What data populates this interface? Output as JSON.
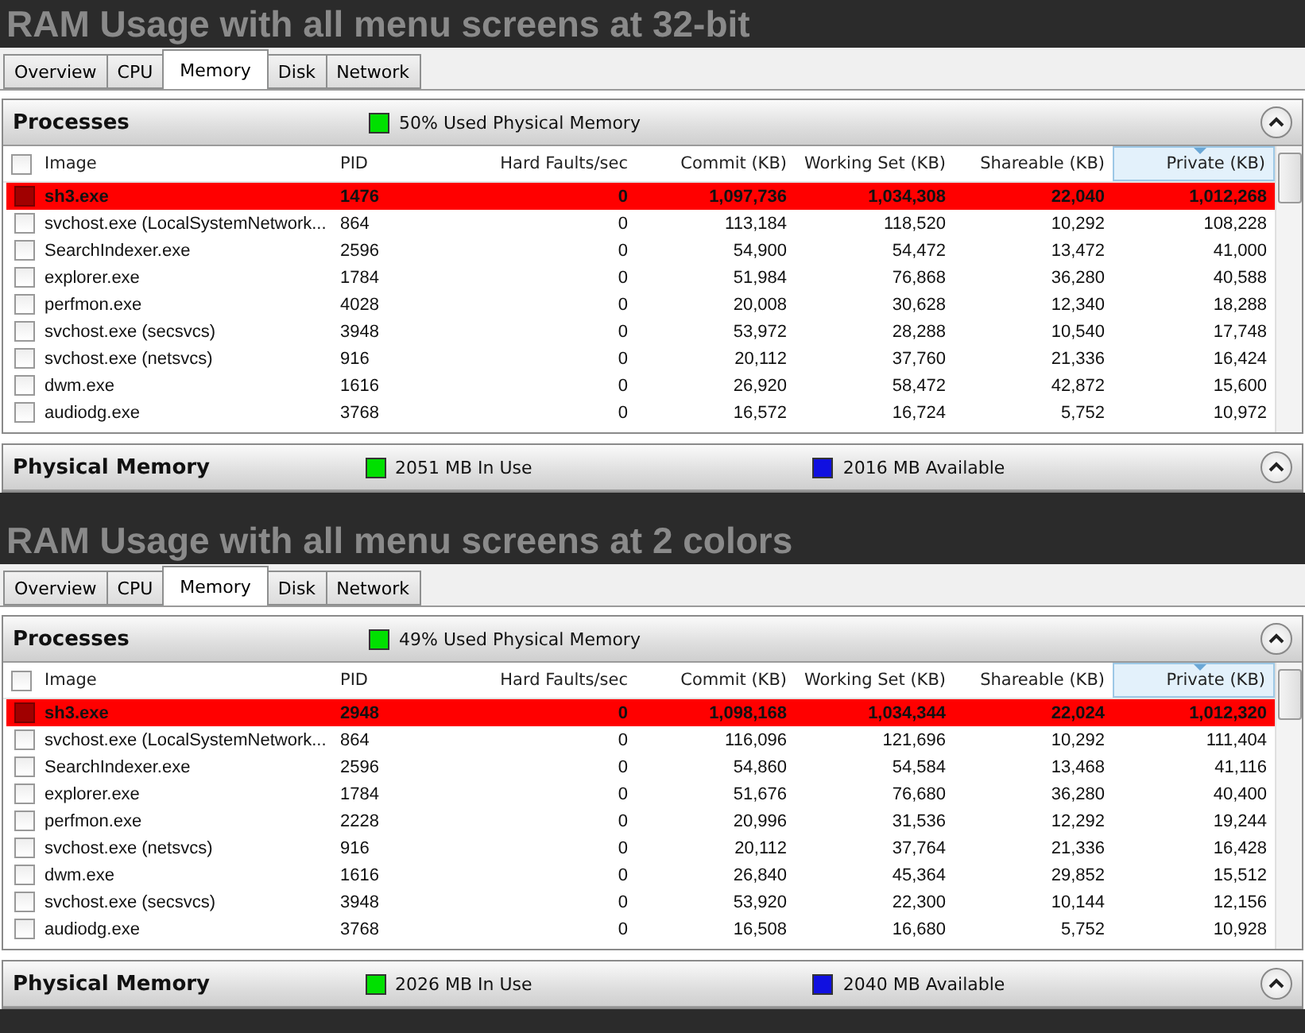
{
  "panels": [
    {
      "title": "RAM Usage with all menu screens at 32-bit",
      "tabs": [
        {
          "label": "Overview",
          "selected": false
        },
        {
          "label": "CPU",
          "selected": false
        },
        {
          "label": "Memory",
          "selected": true
        },
        {
          "label": "Disk",
          "selected": false
        },
        {
          "label": "Network",
          "selected": false
        }
      ],
      "processes": {
        "title": "Processes",
        "legend": {
          "label": "50% Used Physical Memory",
          "color": "#00e000"
        }
      },
      "columns": [
        {
          "label": "Image",
          "sorted": false
        },
        {
          "label": "PID",
          "sorted": false
        },
        {
          "label": "Hard Faults/sec",
          "sorted": false
        },
        {
          "label": "Commit (KB)",
          "sorted": false
        },
        {
          "label": "Working Set (KB)",
          "sorted": false
        },
        {
          "label": "Shareable (KB)",
          "sorted": false
        },
        {
          "label": "Private (KB)",
          "sorted": true
        }
      ],
      "rows": [
        {
          "cells": [
            "sh3.exe",
            "1476",
            "0",
            "1,097,736",
            "1,034,308",
            "22,040",
            "1,012,268"
          ],
          "selected": true,
          "checked": false
        },
        {
          "cells": [
            "svchost.exe (LocalSystemNetwork...",
            "864",
            "0",
            "113,184",
            "118,520",
            "10,292",
            "108,228"
          ],
          "selected": false,
          "checked": false
        },
        {
          "cells": [
            "SearchIndexer.exe",
            "2596",
            "0",
            "54,900",
            "54,472",
            "13,472",
            "41,000"
          ],
          "selected": false,
          "checked": false
        },
        {
          "cells": [
            "explorer.exe",
            "1784",
            "0",
            "51,984",
            "76,868",
            "36,280",
            "40,588"
          ],
          "selected": false,
          "checked": false
        },
        {
          "cells": [
            "perfmon.exe",
            "4028",
            "0",
            "20,008",
            "30,628",
            "12,340",
            "18,288"
          ],
          "selected": false,
          "checked": false
        },
        {
          "cells": [
            "svchost.exe (secsvcs)",
            "3948",
            "0",
            "53,972",
            "28,288",
            "10,540",
            "17,748"
          ],
          "selected": false,
          "checked": false
        },
        {
          "cells": [
            "svchost.exe (netsvcs)",
            "916",
            "0",
            "20,112",
            "37,760",
            "21,336",
            "16,424"
          ],
          "selected": false,
          "checked": false
        },
        {
          "cells": [
            "dwm.exe",
            "1616",
            "0",
            "26,920",
            "58,472",
            "42,872",
            "15,600"
          ],
          "selected": false,
          "checked": false
        },
        {
          "cells": [
            "audiodg.exe",
            "3768",
            "0",
            "16,572",
            "16,724",
            "5,752",
            "10,972"
          ],
          "selected": false,
          "checked": false
        }
      ],
      "physical": {
        "title": "Physical Memory",
        "legends": [
          {
            "label": "2051 MB In Use",
            "color": "#00e000"
          },
          {
            "label": "2016 MB Available",
            "color": "#1010e0"
          }
        ]
      }
    },
    {
      "title": "RAM Usage with all menu screens at 2 colors",
      "tabs": [
        {
          "label": "Overview",
          "selected": false
        },
        {
          "label": "CPU",
          "selected": false
        },
        {
          "label": "Memory",
          "selected": true
        },
        {
          "label": "Disk",
          "selected": false
        },
        {
          "label": "Network",
          "selected": false
        }
      ],
      "processes": {
        "title": "Processes",
        "legend": {
          "label": "49% Used Physical Memory",
          "color": "#00e000"
        }
      },
      "columns": [
        {
          "label": "Image",
          "sorted": false
        },
        {
          "label": "PID",
          "sorted": false
        },
        {
          "label": "Hard Faults/sec",
          "sorted": false
        },
        {
          "label": "Commit (KB)",
          "sorted": false
        },
        {
          "label": "Working Set (KB)",
          "sorted": false
        },
        {
          "label": "Shareable (KB)",
          "sorted": false
        },
        {
          "label": "Private (KB)",
          "sorted": true
        }
      ],
      "rows": [
        {
          "cells": [
            "sh3.exe",
            "2948",
            "0",
            "1,098,168",
            "1,034,344",
            "22,024",
            "1,012,320"
          ],
          "selected": true,
          "checked": false
        },
        {
          "cells": [
            "svchost.exe (LocalSystemNetwork...",
            "864",
            "0",
            "116,096",
            "121,696",
            "10,292",
            "111,404"
          ],
          "selected": false,
          "checked": false
        },
        {
          "cells": [
            "SearchIndexer.exe",
            "2596",
            "0",
            "54,860",
            "54,584",
            "13,468",
            "41,116"
          ],
          "selected": false,
          "checked": false
        },
        {
          "cells": [
            "explorer.exe",
            "1784",
            "0",
            "51,676",
            "76,680",
            "36,280",
            "40,400"
          ],
          "selected": false,
          "checked": false
        },
        {
          "cells": [
            "perfmon.exe",
            "2228",
            "0",
            "20,996",
            "31,536",
            "12,292",
            "19,244"
          ],
          "selected": false,
          "checked": false
        },
        {
          "cells": [
            "svchost.exe (netsvcs)",
            "916",
            "0",
            "20,112",
            "37,764",
            "21,336",
            "16,428"
          ],
          "selected": false,
          "checked": false
        },
        {
          "cells": [
            "dwm.exe",
            "1616",
            "0",
            "26,840",
            "45,364",
            "29,852",
            "15,512"
          ],
          "selected": false,
          "checked": false
        },
        {
          "cells": [
            "svchost.exe (secsvcs)",
            "3948",
            "0",
            "53,920",
            "22,300",
            "10,144",
            "12,156"
          ],
          "selected": false,
          "checked": false
        },
        {
          "cells": [
            "audiodg.exe",
            "3768",
            "0",
            "16,508",
            "16,680",
            "5,752",
            "10,928"
          ],
          "selected": false,
          "checked": false
        }
      ],
      "physical": {
        "title": "Physical Memory",
        "legends": [
          {
            "label": "2026 MB In Use",
            "color": "#00e000"
          },
          {
            "label": "2040 MB Available",
            "color": "#1010e0"
          }
        ]
      }
    }
  ]
}
